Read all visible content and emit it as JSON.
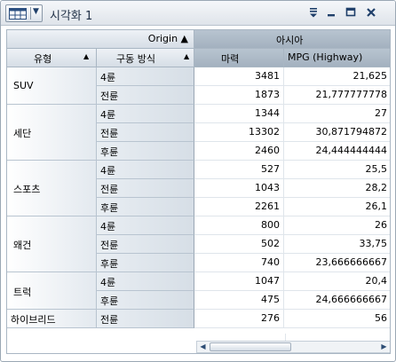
{
  "window": {
    "title": "시각화 1"
  },
  "table": {
    "col_header_origin": "Origin ▲",
    "col_header_region": "아시아",
    "row_header_type": "유형",
    "row_header_drive": "구동 방식",
    "sort_up": "▲",
    "measure_1": "마력",
    "measure_2": "MPG (Highway)",
    "groups": [
      {
        "type": "SUV",
        "rows": [
          {
            "drive": "4륜",
            "hp": "3481",
            "mpg": "21,625"
          },
          {
            "drive": "전륜",
            "hp": "1873",
            "mpg": "21,777777778"
          }
        ]
      },
      {
        "type": "세단",
        "rows": [
          {
            "drive": "4륜",
            "hp": "1344",
            "mpg": "27"
          },
          {
            "drive": "전륜",
            "hp": "13302",
            "mpg": "30,871794872"
          },
          {
            "drive": "후륜",
            "hp": "2460",
            "mpg": "24,444444444"
          }
        ]
      },
      {
        "type": "스포츠",
        "rows": [
          {
            "drive": "4륜",
            "hp": "527",
            "mpg": "25,5"
          },
          {
            "drive": "전륜",
            "hp": "1043",
            "mpg": "28,2"
          },
          {
            "drive": "후륜",
            "hp": "2261",
            "mpg": "26,1"
          }
        ]
      },
      {
        "type": "왜건",
        "rows": [
          {
            "drive": "4륜",
            "hp": "800",
            "mpg": "26"
          },
          {
            "drive": "전륜",
            "hp": "502",
            "mpg": "33,75"
          },
          {
            "drive": "후륜",
            "hp": "740",
            "mpg": "23,666666667"
          }
        ]
      },
      {
        "type": "트럭",
        "rows": [
          {
            "drive": "4륜",
            "hp": "1047",
            "mpg": "20,4"
          },
          {
            "drive": "후륜",
            "hp": "475",
            "mpg": "24,666666667"
          }
        ]
      },
      {
        "type": "하이브리드",
        "rows": [
          {
            "drive": "전륜",
            "hp": "276",
            "mpg": "56"
          }
        ]
      }
    ]
  },
  "scrollbar": {
    "left_arrow": "◀",
    "right_arrow": "▶"
  }
}
